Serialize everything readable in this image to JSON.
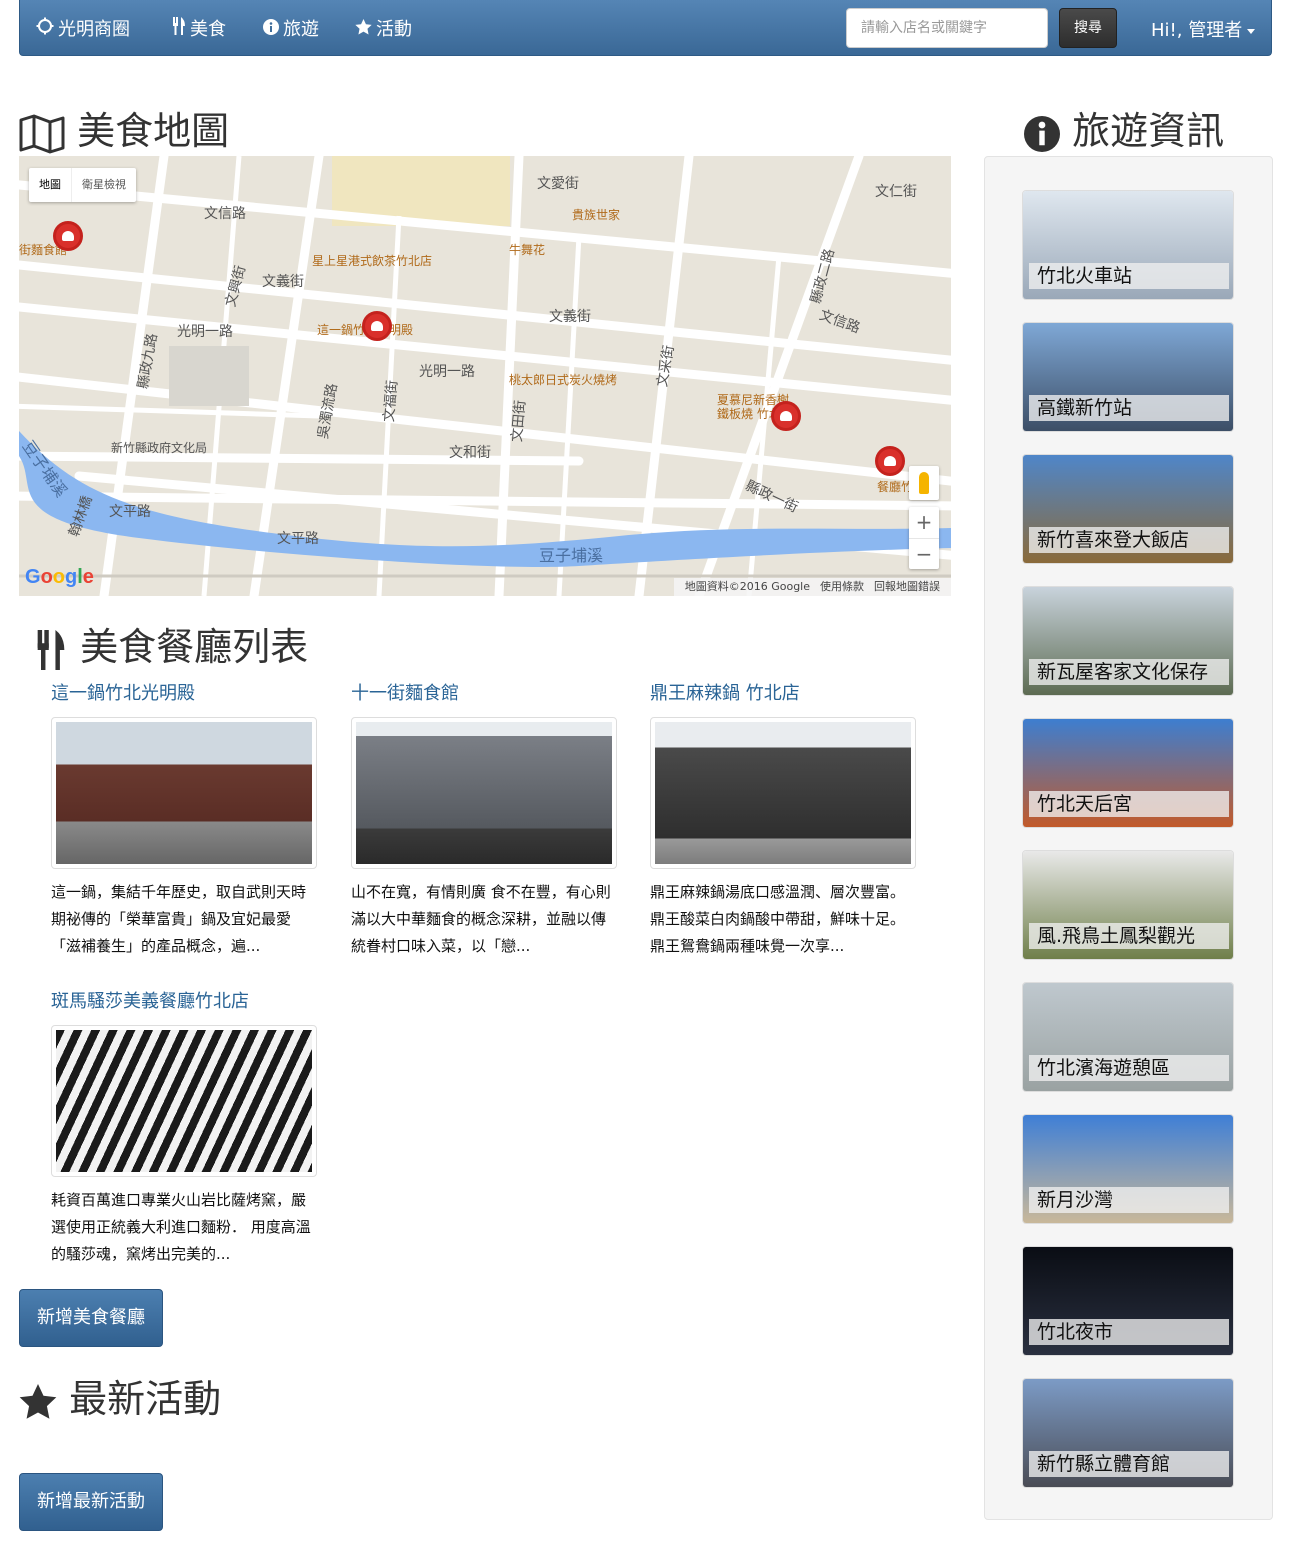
{
  "navbar": {
    "brand": "光明商圈",
    "links": [
      {
        "label": "美食",
        "icon": "cutlery-icon"
      },
      {
        "label": "旅遊",
        "icon": "info-circle-icon"
      },
      {
        "label": "活動",
        "icon": "star-icon"
      }
    ],
    "search_placeholder": "請輸入店名或關鍵字",
    "search_button": "搜尋",
    "user_greeting": "Hi!, 管理者"
  },
  "food_map": {
    "heading": "美食地圖",
    "map_type_buttons": [
      "地圖",
      "衛星檢視"
    ],
    "street_labels": [
      "文信路",
      "文義街",
      "光明一路",
      "文愛街",
      "文仁街",
      "縣政二路",
      "縣政九路",
      "文平路",
      "文和街",
      "文田街",
      "文采街",
      "文福街",
      "文興街",
      "吳濁流路",
      "文義街",
      "光明一路",
      "文信路",
      "豆子埔溪",
      "豆子埔溪",
      "翰林橋",
      "縣政一街",
      "文平路"
    ],
    "poi_labels": [
      "貴族世家",
      "牛舞花",
      "星上星港式飲茶竹北店",
      "這一鍋竹北光明殿",
      "桃太郎日式炭火燒烤",
      "夏慕尼新香榭鐵板燒 竹北",
      "新竹縣政府文化局",
      "街麵食館",
      "餐廳竹"
    ],
    "footer": [
      "地圖資料©2016 Google",
      "使用條款",
      "回報地圖錯誤"
    ],
    "logo": "Google"
  },
  "restaurants": {
    "heading": "美食餐廳列表",
    "items": [
      {
        "name": "這一鍋竹北光明殿",
        "desc": "這一鍋，集結千年歷史，取自武則天時期祕傳的「榮華富貴」鍋及宜妃最愛「滋補養生」的產品概念，遍..."
      },
      {
        "name": "十一街麵食館",
        "desc": "山不在寬，有情則廣 食不在豐，有心則滿以大中華麵食的概念深耕，並融以傳統眷村口味入菜，以「戀..."
      },
      {
        "name": "鼎王麻辣鍋 竹北店",
        "desc": "鼎王麻辣鍋湯底口感溫潤、層次豐富。鼎王酸菜白肉鍋酸中帶甜，鮮味十足。鼎王鴛鴦鍋兩種味覺一次享..."
      },
      {
        "name": "斑馬騷莎美義餐廳竹北店",
        "desc": "耗資百萬進口專業火山岩比薩烤窯，嚴選使用正統義大利進口麵粉． 用度高溫的騷莎魂，窯烤出完美的..."
      }
    ],
    "add_button": "新增美食餐廳"
  },
  "events": {
    "heading": "最新活動",
    "add_button": "新增最新活動"
  },
  "travel": {
    "heading": "旅遊資訊",
    "items": [
      {
        "name": "竹北火車站",
        "colors": [
          "#dfe7ef",
          "#9aa8b8"
        ]
      },
      {
        "name": "高鐵新竹站",
        "colors": [
          "#7fa8d6",
          "#3c4e66"
        ]
      },
      {
        "name": "新竹喜來登大飯店",
        "colors": [
          "#4f86c9",
          "#8a6a3a"
        ]
      },
      {
        "name": "新瓦屋客家文化保存",
        "colors": [
          "#c9d3dc",
          "#5d6b52"
        ]
      },
      {
        "name": "竹北天后宮",
        "colors": [
          "#3d7ed0",
          "#c25a2a"
        ]
      },
      {
        "name": "風.飛鳥土鳳梨觀光",
        "colors": [
          "#e9e9e9",
          "#6f7f4a"
        ]
      },
      {
        "name": "竹北濱海遊憩區",
        "colors": [
          "#bfc8ce",
          "#9aa2a2"
        ]
      },
      {
        "name": "新月沙灣",
        "colors": [
          "#3f7fd6",
          "#c9b89a"
        ]
      },
      {
        "name": "竹北夜市",
        "colors": [
          "#0a0d14",
          "#2a3040"
        ]
      },
      {
        "name": "新竹縣立體育館",
        "colors": [
          "#7c9bc6",
          "#4a4c55"
        ]
      }
    ]
  }
}
